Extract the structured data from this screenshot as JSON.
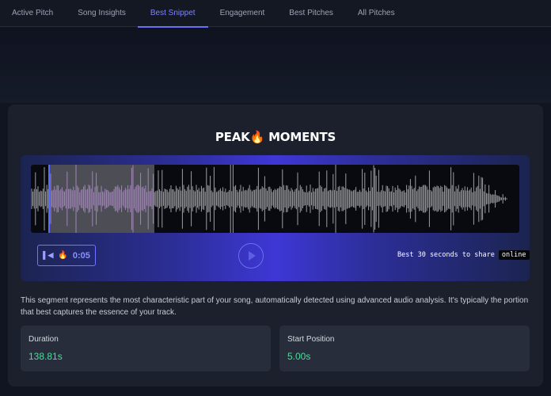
{
  "nav": {
    "tabs": [
      {
        "label": "Active Pitch"
      },
      {
        "label": "Song Insights"
      },
      {
        "label": "Best Snippet"
      },
      {
        "label": "Engagement"
      },
      {
        "label": "Best Pitches"
      },
      {
        "label": "All Pitches"
      }
    ],
    "active_tab": "Best Snippet",
    "accent_color": "#6a6ff5"
  },
  "peak": {
    "title_left": "PEAK",
    "title_icon": "🔥",
    "title_right": "MOMENTS"
  },
  "player": {
    "skip_icon": "skip-back-icon",
    "time_icon": "🔥",
    "time": "0:05",
    "play_icon": "play-icon",
    "share_text": "Best 30 seconds to share",
    "share_badge": "online"
  },
  "description": "This segment represents the most characteristic part of your song, automatically detected using advanced audio analysis. It's typically the portion that best captures the essence of your track.",
  "stats": {
    "duration": {
      "label": "Duration",
      "value": "138.81s"
    },
    "start": {
      "label": "Start Position",
      "value": "5.00s"
    }
  },
  "colors": {
    "value_green": "#4ade9c",
    "selected_wave": "#b27bd6"
  }
}
